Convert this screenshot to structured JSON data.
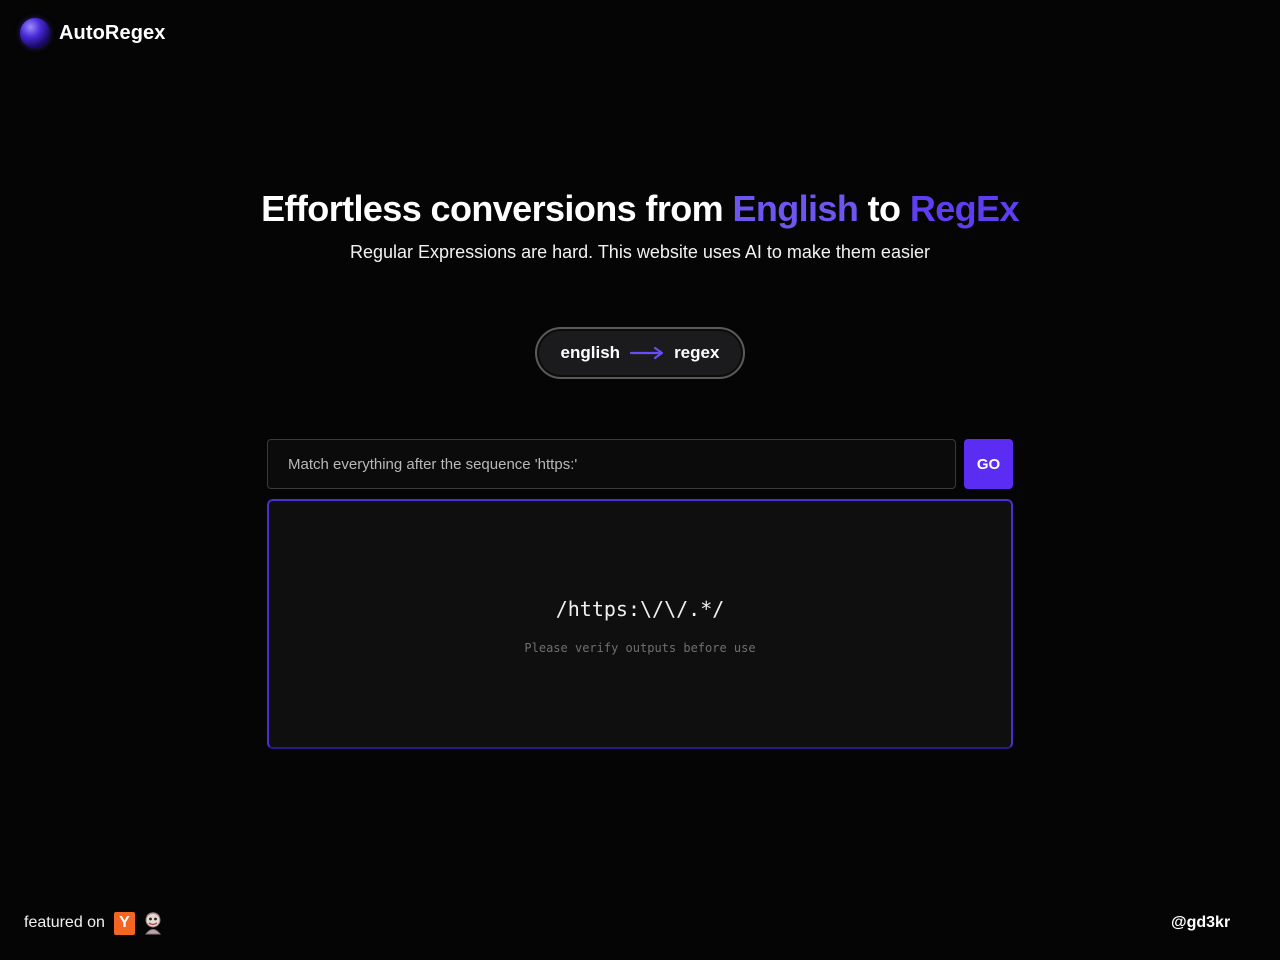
{
  "header": {
    "brand": "AutoRegex",
    "logo_icon": "purple-orb-icon"
  },
  "hero": {
    "title_part1": "Effortless conversions from ",
    "title_accent1": "English",
    "title_part2": " to ",
    "title_accent2": "RegEx",
    "subtitle": "Regular Expressions are hard. This website uses AI to make them easier"
  },
  "mode_toggle": {
    "from": "english",
    "to": "regex",
    "icon": "arrow-right-icon"
  },
  "prompt": {
    "placeholder": "Match everything after the sequence 'https:'",
    "value": ""
  },
  "go_button": {
    "label": "GO"
  },
  "output": {
    "regex": "/https:\\/\\/.*/",
    "note": "Please verify outputs before use"
  },
  "footer": {
    "featured_label": "featured on",
    "yc_badge": "Y",
    "yc_icon": "y-combinator-icon",
    "mascot_icon": "mascot-icon",
    "handle": "@gd3kr"
  },
  "colors": {
    "background": "#050505",
    "accent_english": "#6d55f0",
    "accent_regex": "#5f3df0",
    "button": "#5b2cf2",
    "panel_border": "#4a2fd0",
    "yc_orange": "#f26522"
  }
}
